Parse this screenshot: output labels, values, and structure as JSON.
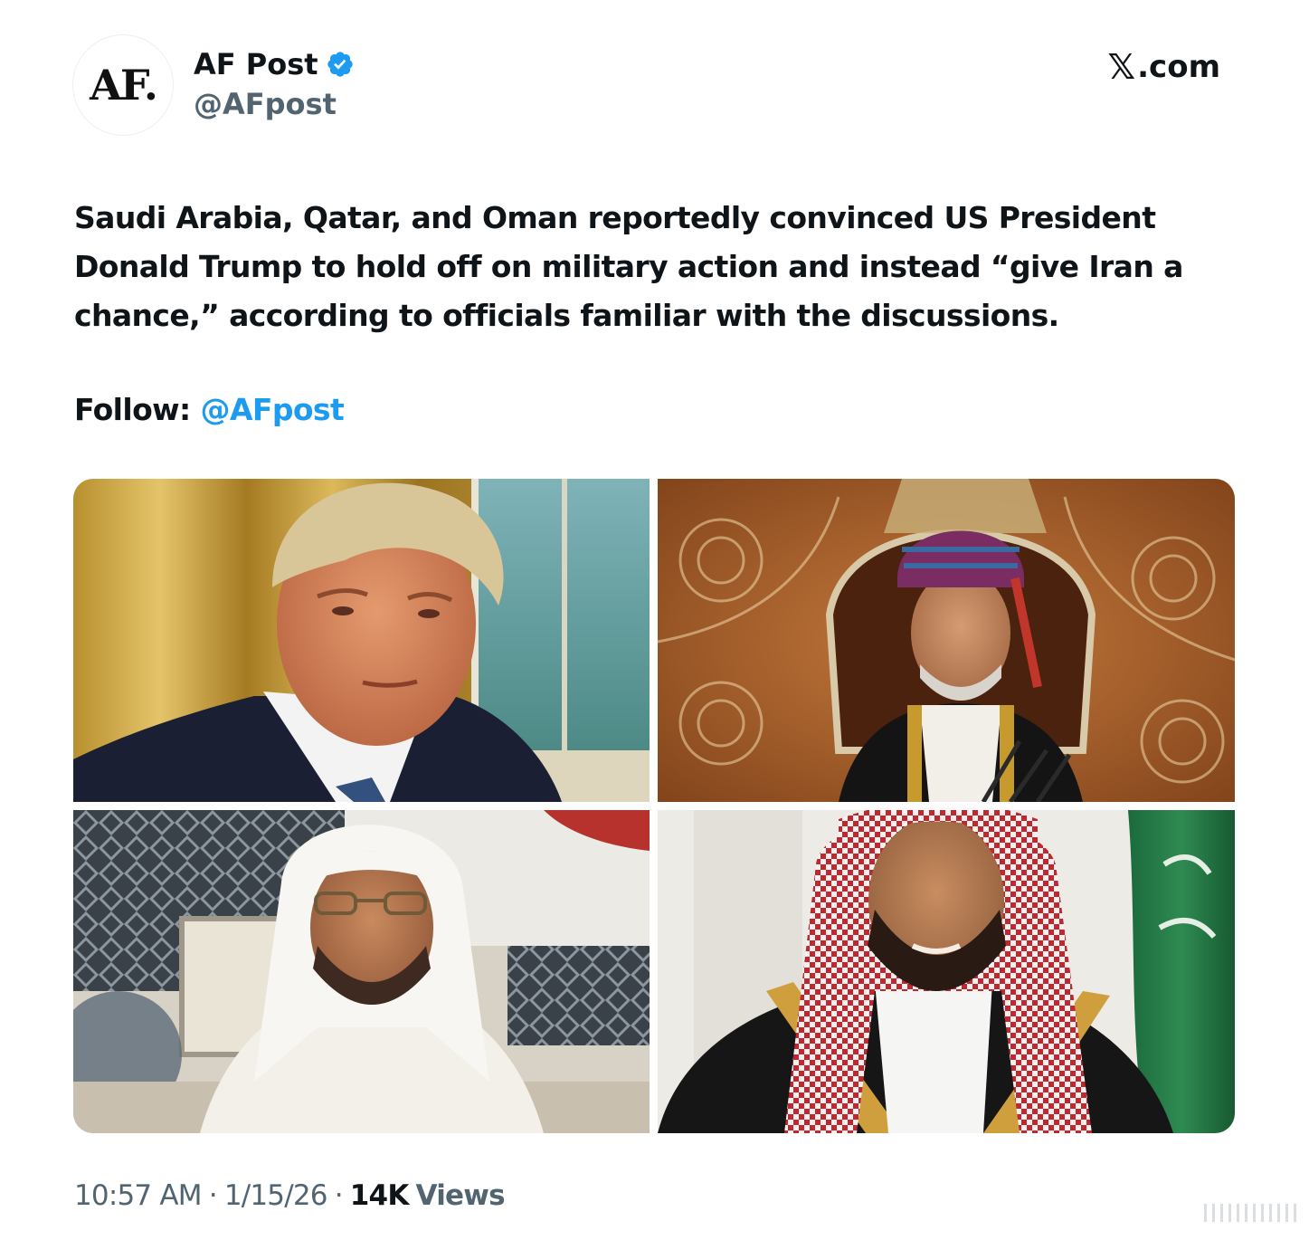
{
  "header": {
    "avatar_text": "AF.",
    "display_name": "AF Post",
    "handle": "@AFpost",
    "brand_x": "𝕏",
    "brand_suffix": ".com",
    "verified_color": "#1d9bf0"
  },
  "post": {
    "text": "Saudi Arabia, Qatar, and Oman reportedly convinced US President Donald Trump to hold off on military action and instead “give Iran a chance,” according to officials familiar with the discussions.",
    "follow_label": "Follow:",
    "follow_mention": "@AFpost"
  },
  "media": {
    "photos": [
      {
        "subject": "man in dark suit and blue tie, gold curtains, window"
      },
      {
        "subject": "man in turban and black robe with gold trim on carved throne"
      },
      {
        "subject": "man in white ghutra and glasses, patterned screen"
      },
      {
        "subject": "man in red-white shemagh with green flag"
      }
    ]
  },
  "footer": {
    "time": "10:57 AM",
    "date": "1/15/26",
    "views_count": "14K",
    "views_label": "Views",
    "separator": "·"
  },
  "colors": {
    "text": "#0f1419",
    "secondary": "#536471",
    "link": "#1d9bf0"
  }
}
